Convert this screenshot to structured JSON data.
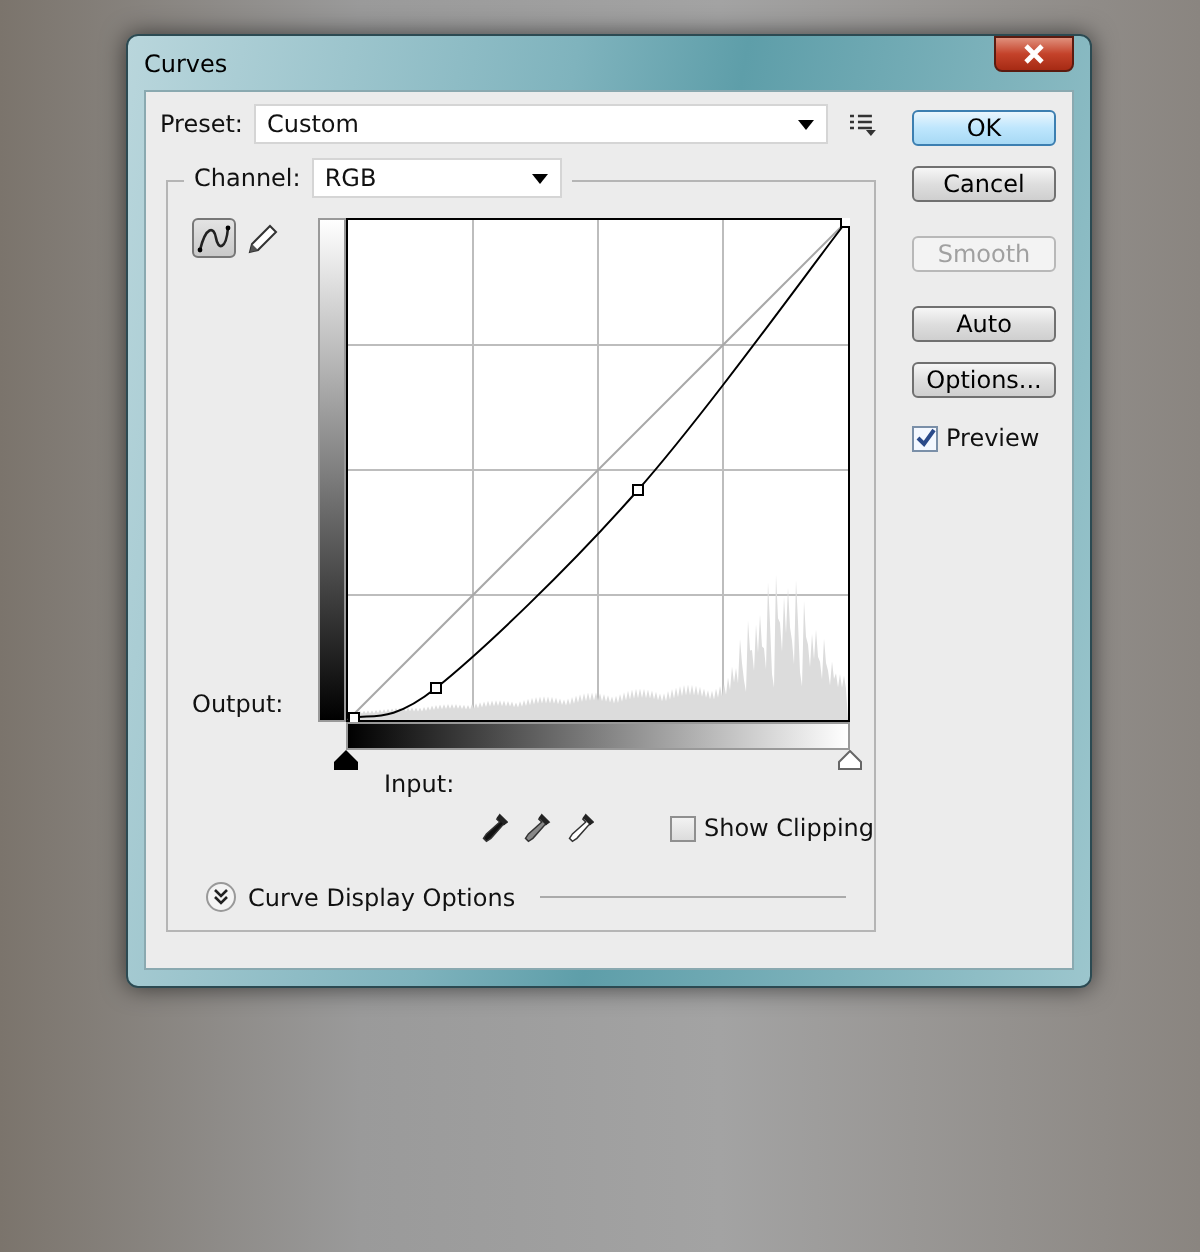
{
  "window": {
    "title": "Curves"
  },
  "preset": {
    "label": "Preset:",
    "value": "Custom"
  },
  "channel": {
    "label": "Channel:",
    "value": "RGB"
  },
  "tools": [
    {
      "kind": "curve",
      "selected": true
    },
    {
      "kind": "pencil",
      "selected": false
    }
  ],
  "graph": {
    "output_label": "Output:",
    "input_label": "Input:"
  },
  "input_sliders": [
    {
      "kind": "shadow",
      "level": 0
    },
    {
      "kind": "highlight",
      "level": 1
    }
  ],
  "eyedroppers": [
    {
      "kind": "black"
    },
    {
      "kind": "gray"
    },
    {
      "kind": "white"
    }
  ],
  "show_clipping": {
    "label": "Show Clipping",
    "checked": false
  },
  "display_options": {
    "label": "Curve Display Options",
    "expanded": false
  },
  "buttons": [
    {
      "label": "OK",
      "default": true,
      "disabled": false
    },
    {
      "label": "Cancel",
      "default": false,
      "disabled": false
    },
    {
      "label": "Smooth",
      "default": false,
      "disabled": true
    },
    {
      "label": "Auto",
      "default": false,
      "disabled": false
    },
    {
      "label": "Options...",
      "default": false,
      "disabled": false
    }
  ],
  "preview": {
    "label": "Preview",
    "checked": true
  }
}
